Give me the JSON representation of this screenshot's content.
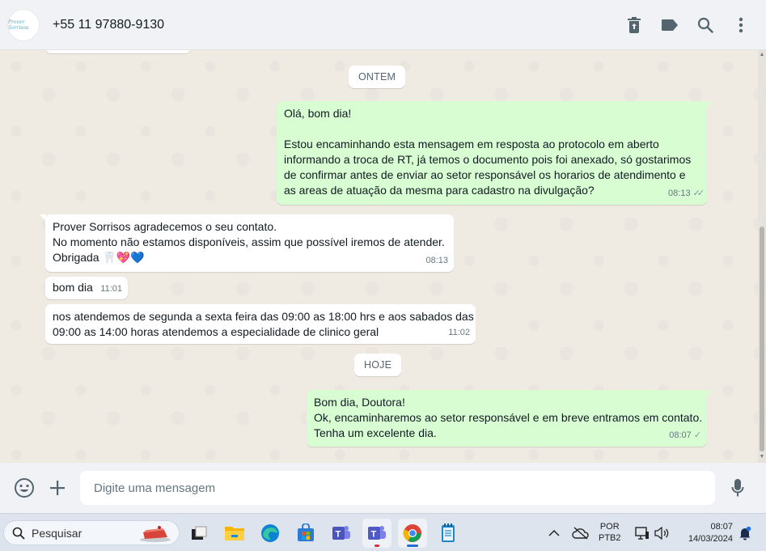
{
  "header": {
    "contact_name": "+55 11 97880-9130",
    "avatar_text": "Prover Sorrisos",
    "icons": [
      "delete-icon",
      "label-icon",
      "search-icon",
      "menu-icon"
    ]
  },
  "chat": {
    "date_yesterday": "ONTEM",
    "date_today": "HOJE",
    "messages": [
      {
        "direction": "out",
        "lines": [
          "Olá, bom dia!",
          "",
          "Estou encaminhando esta mensagem em resposta ao protocolo em aberto",
          "informando a troca de RT, já temos o documento pois foi anexado, só gostarimos",
          "de confirmar antes de enviar ao setor responsável os horarios de atendimento e",
          "as areas de atuação da mesma para cadastro na divulgação?"
        ],
        "time": "08:13",
        "status": "read"
      },
      {
        "direction": "in",
        "lines": [
          "Prover Sorrisos agradecemos o seu contato.",
          "No momento não estamos disponíveis, assim que possível iremos de atender.",
          "Obrigada 🦷💖💙"
        ],
        "time": "08:13"
      },
      {
        "direction": "in",
        "lines": [
          "bom dia"
        ],
        "time": "11:01"
      },
      {
        "direction": "in",
        "lines": [
          "nos atendemos de segunda a sexta feira das 09:00 as 18:00 hrs e aos sabados das",
          "09:00 as 14:00 horas atendemos a especialidade de clinico geral"
        ],
        "time": "11:02"
      },
      {
        "direction": "out",
        "lines": [
          "Bom dia, Doutora!",
          "Ok, encaminharemos ao setor responsável e em breve entramos em contato.",
          "Tenha um excelente dia."
        ],
        "time": "08:07",
        "status": "sent"
      }
    ]
  },
  "composer": {
    "placeholder": "Digite uma mensagem"
  },
  "taskbar": {
    "search_label": "Pesquisar",
    "language": "POR",
    "keyboard": "PTB2",
    "time": "08:07",
    "date": "14/03/2024"
  },
  "colors": {
    "outgoing_bubble": "#d9fdd3",
    "incoming_bubble": "#ffffff",
    "chat_background": "#efeae2",
    "header_background": "#f0f2f5"
  }
}
